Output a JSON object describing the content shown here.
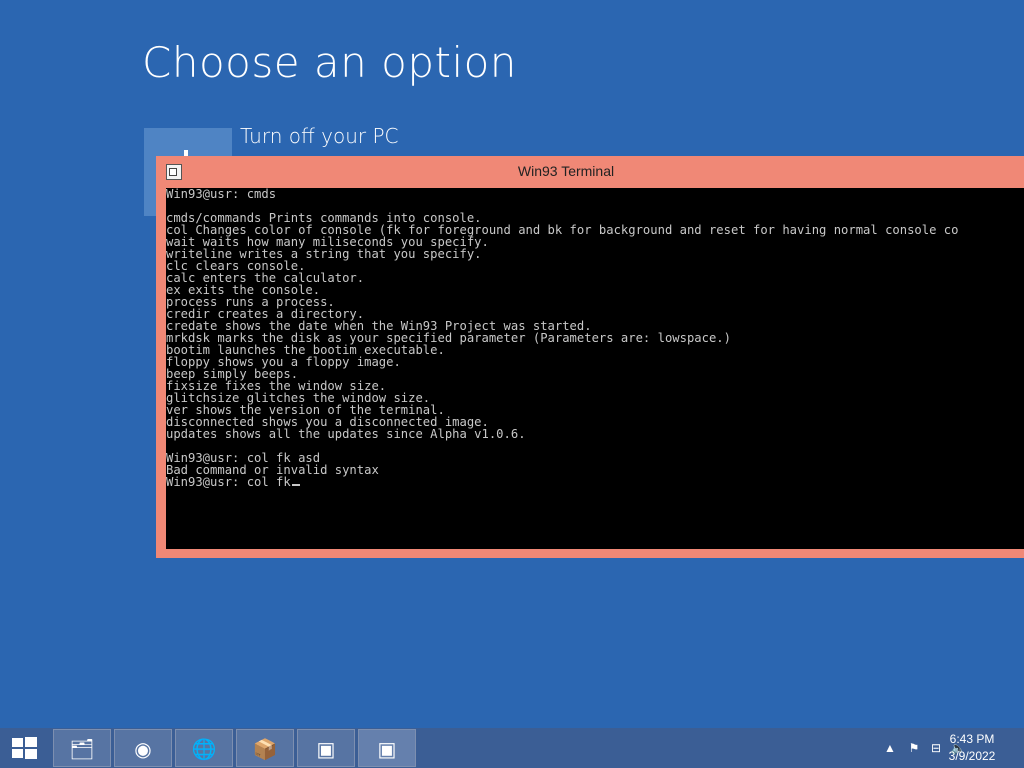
{
  "screen": {
    "title": "Choose an option",
    "option_label": "Turn off your PC"
  },
  "terminal": {
    "title": "Win93 Terminal",
    "lines": [
      "Win93@usr: cmds",
      "",
      "cmds/commands Prints commands into console.",
      "col Changes color of console (fk for foreground and bk for background and reset for having normal console co",
      "wait waits how many miliseconds you specify.",
      "writeline writes a string that you specify.",
      "clc clears console.",
      "calc enters the calculator.",
      "ex exits the console.",
      "process runs a process.",
      "credir creates a directory.",
      "credate shows the date when the Win93 Project was started.",
      "mrkdsk marks the disk as your specified parameter (Parameters are: lowspace.)",
      "bootim launches the bootim executable.",
      "floppy shows you a floppy image.",
      "beep simply beeps.",
      "fixsize fixes the window size.",
      "glitchsize glitches the window size.",
      "ver shows the version of the terminal.",
      "disconnected shows you a disconnected image.",
      "updates shows all the updates since Alpha v1.0.6.",
      "",
      "Win93@usr: col fk asd",
      "Bad command or invalid syntax"
    ],
    "prompt": "Win93@usr: col fk"
  },
  "taskbar": {
    "apps": [
      {
        "name": "file-explorer-icon",
        "glyph": "🗂"
      },
      {
        "name": "chrome-icon",
        "glyph": "◉"
      },
      {
        "name": "network-globe-icon",
        "glyph": "🌐"
      },
      {
        "name": "setup-package-icon",
        "glyph": "📦"
      },
      {
        "name": "terminal-window-icon",
        "glyph": "▣"
      },
      {
        "name": "terminal-window-icon-2",
        "glyph": "▣"
      }
    ],
    "clock": {
      "time": "6:43 PM",
      "date": "3/9/2022"
    }
  },
  "colors": {
    "desktop": "#2b66b1",
    "terminal_frame": "#f08876",
    "terminal_bg": "#000000",
    "terminal_fg": "#c8c8c8",
    "taskbar": "#3b5e95"
  }
}
